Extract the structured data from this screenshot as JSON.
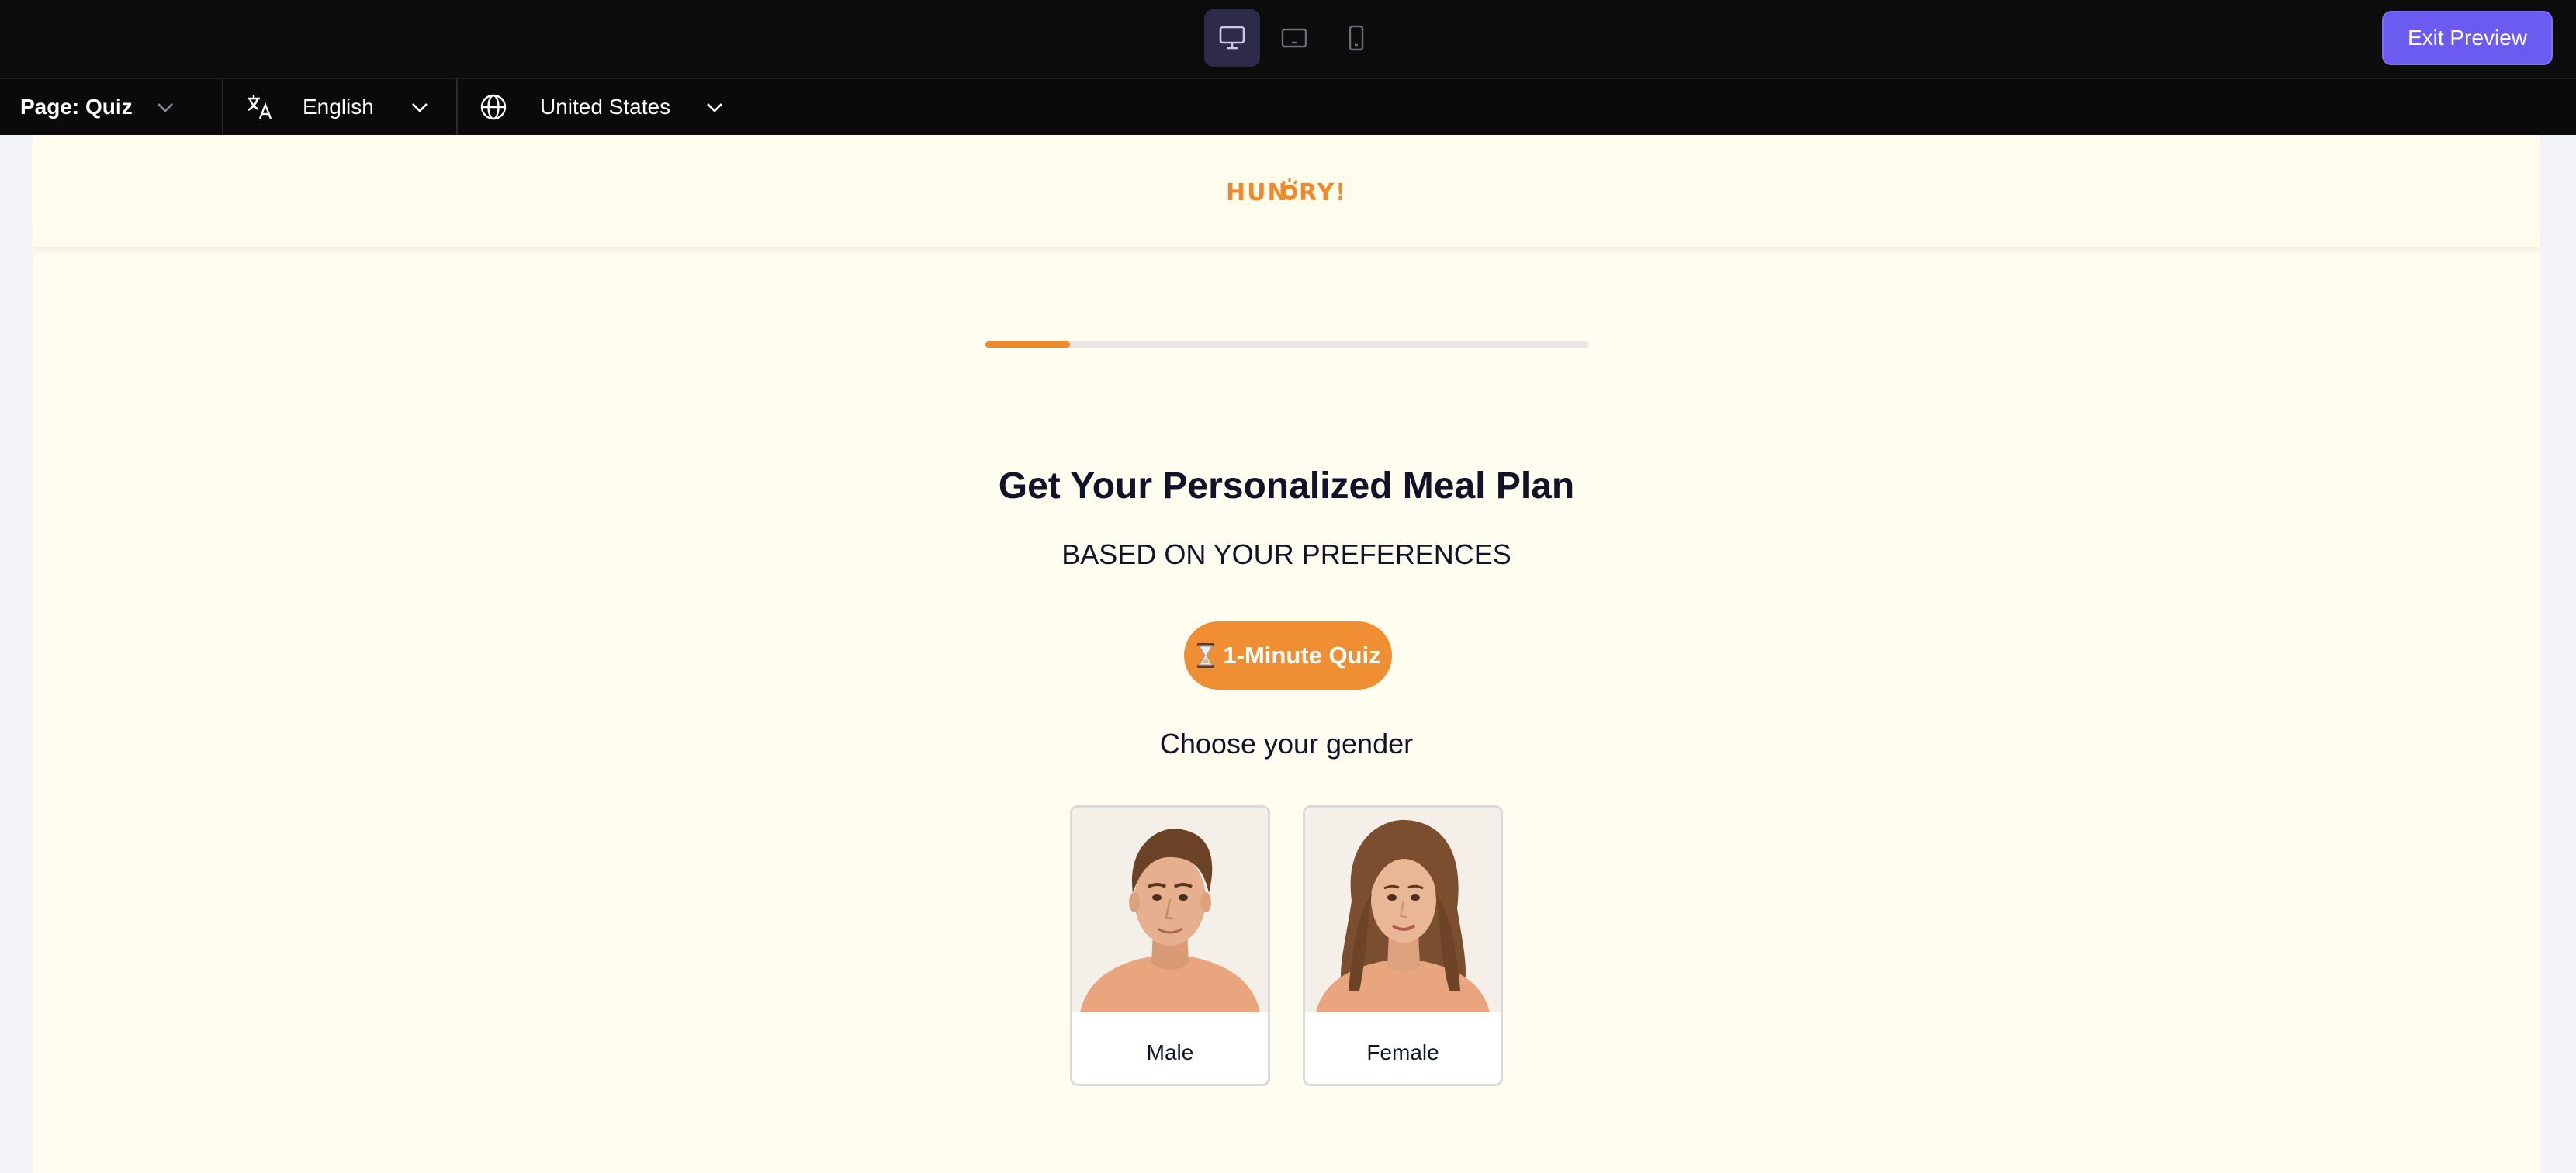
{
  "toolbar": {
    "devices": [
      {
        "name": "desktop",
        "active": true
      },
      {
        "name": "tablet",
        "active": false
      },
      {
        "name": "mobile",
        "active": false
      }
    ],
    "exit_label": "Exit Preview",
    "accent": "#6c5bf0"
  },
  "subbar": {
    "page_label": "Page: Quiz",
    "language": "English",
    "country": "United States"
  },
  "site": {
    "logo_text": "HUNGRY!",
    "brand_color": "#ef8a2a",
    "progress": 0.14,
    "title": "Get Your Personalized Meal Plan",
    "subtitle": "BASED ON YOUR PREFERENCES",
    "pill_label": "1-Minute Quiz",
    "pill_icon": "hourglass-icon",
    "question": "Choose your gender",
    "options": [
      {
        "label": "Male"
      },
      {
        "label": "Female"
      }
    ]
  }
}
